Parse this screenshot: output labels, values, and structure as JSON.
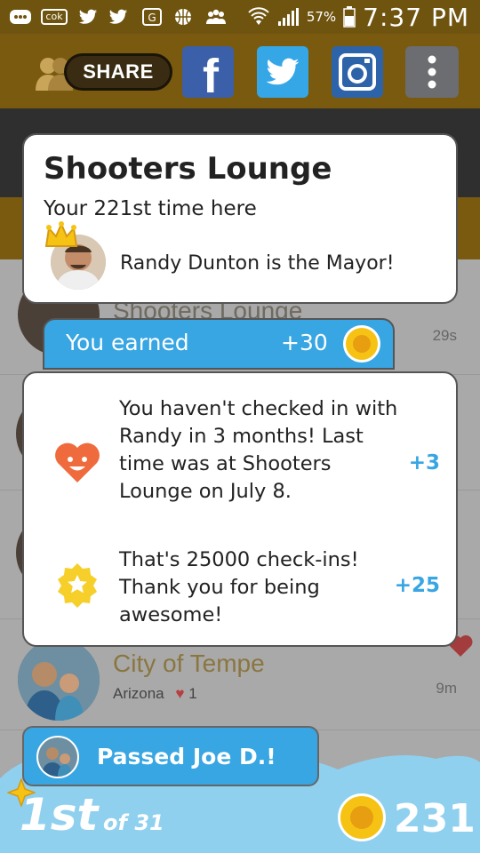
{
  "status_bar": {
    "badges": [
      "cok"
    ],
    "battery": "57%",
    "time": "7:37 PM"
  },
  "share_bar": {
    "share_label": "SHARE",
    "networks": [
      "facebook-icon",
      "twitter-icon",
      "instagram-icon",
      "more-icon"
    ]
  },
  "checkin_card": {
    "venue": "Shooters Lounge",
    "visit_text": "Your 221st time here",
    "mayor_text": "Randy Dunton is the Mayor!"
  },
  "earned": {
    "label": "You earned",
    "points": "+30"
  },
  "bonuses": [
    {
      "text": "You haven't checked in with Randy in 3 months! Last time was at Shooters Lounge on July 8.",
      "points": "+3",
      "icon": "heart-face-icon"
    },
    {
      "text": "That's 25000 check-ins! Thank you for being awesome!",
      "points": "+25",
      "icon": "star-badge-icon"
    }
  ],
  "background_list": {
    "row1_title": "Shooters Lounge",
    "row1_time": "29s",
    "row2_title": "City of Tempe",
    "row2_sub": "Arizona",
    "row2_likes": "1",
    "row2_time": "9m"
  },
  "footer": {
    "passed_text": "Passed Joe D.!",
    "rank": "1st",
    "rank_of": "of 31",
    "coins": "231"
  },
  "colors": {
    "accent_blue": "#37a6e2",
    "coin_yellow": "#f6c315",
    "status_brown": "#6f5410"
  }
}
